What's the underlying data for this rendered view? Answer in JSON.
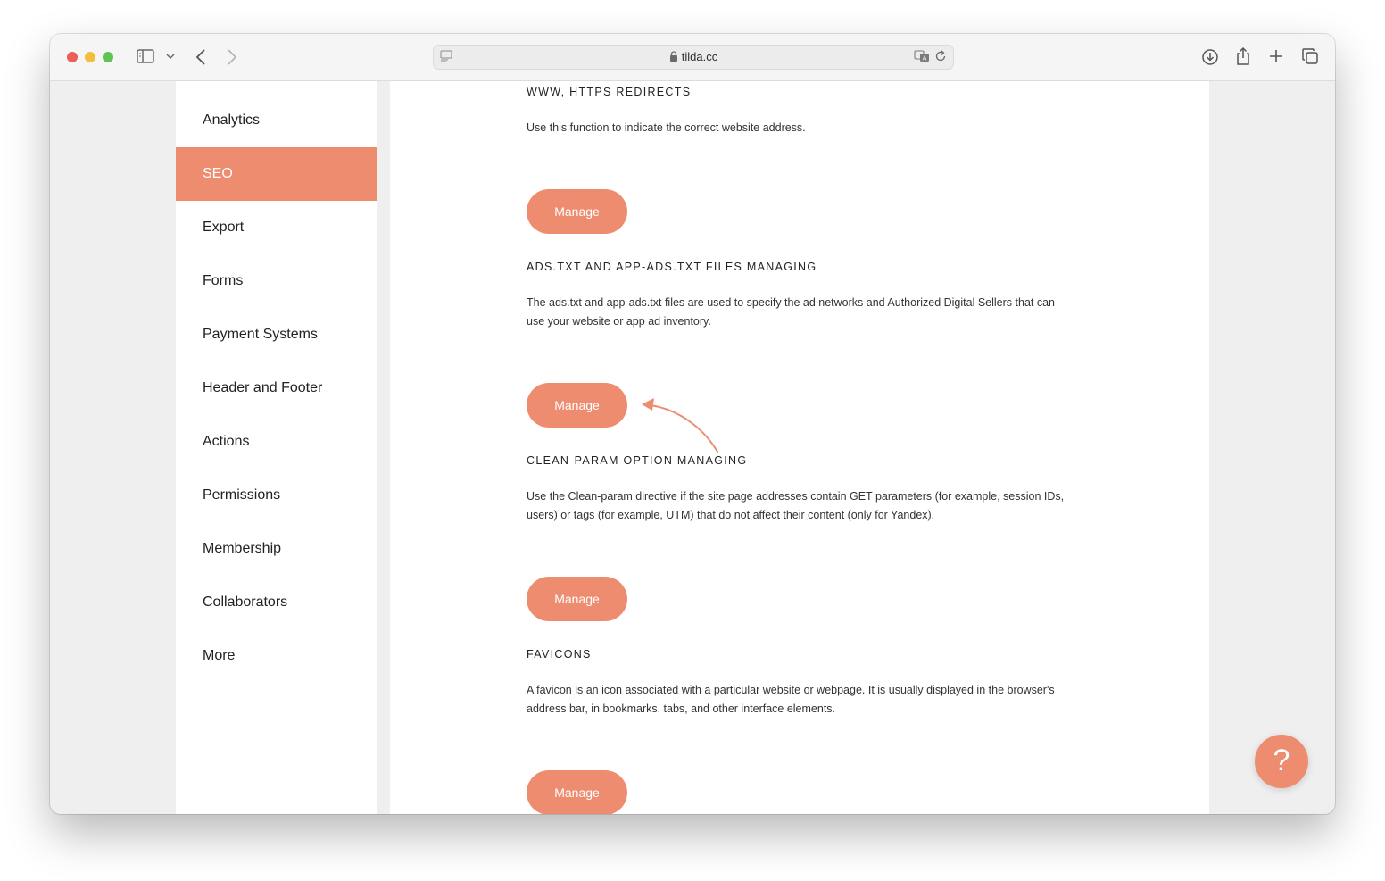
{
  "browser": {
    "url": "tilda.cc"
  },
  "sidebar": {
    "items": [
      {
        "label": "Analytics",
        "active": false
      },
      {
        "label": "SEO",
        "active": true
      },
      {
        "label": "Export",
        "active": false
      },
      {
        "label": "Forms",
        "active": false
      },
      {
        "label": "Payment Systems",
        "active": false
      },
      {
        "label": "Header and Footer",
        "active": false
      },
      {
        "label": "Actions",
        "active": false
      },
      {
        "label": "Permissions",
        "active": false
      },
      {
        "label": "Membership",
        "active": false
      },
      {
        "label": "Collaborators",
        "active": false
      },
      {
        "label": "More",
        "active": false
      }
    ]
  },
  "sections": [
    {
      "title": "WWW, HTTPS REDIRECTS",
      "description": "Use this function to indicate the correct website address.",
      "button": "Manage"
    },
    {
      "title": "ADS.TXT AND APP-ADS.TXT FILES MANAGING",
      "description": "The ads.txt and app-ads.txt files are used to specify the ad networks and Authorized Digital Sellers that can use your website or app ad inventory.",
      "button": "Manage"
    },
    {
      "title": "CLEAN-PARAM OPTION MANAGING",
      "description": "Use the Clean-param directive if the site page addresses contain GET parameters (for example, session IDs, users) or tags (for example, UTM) that do not affect their content (only for Yandex).",
      "button": "Manage"
    },
    {
      "title": "FAVICONS",
      "description": "A favicon is an icon associated with a particular website or webpage. It is usually displayed in the browser's address bar, in bookmarks, tabs, and other interface elements.",
      "button": "Manage"
    }
  ],
  "help_button": "?",
  "colors": {
    "accent": "#ee8c70",
    "text": "#222222"
  }
}
